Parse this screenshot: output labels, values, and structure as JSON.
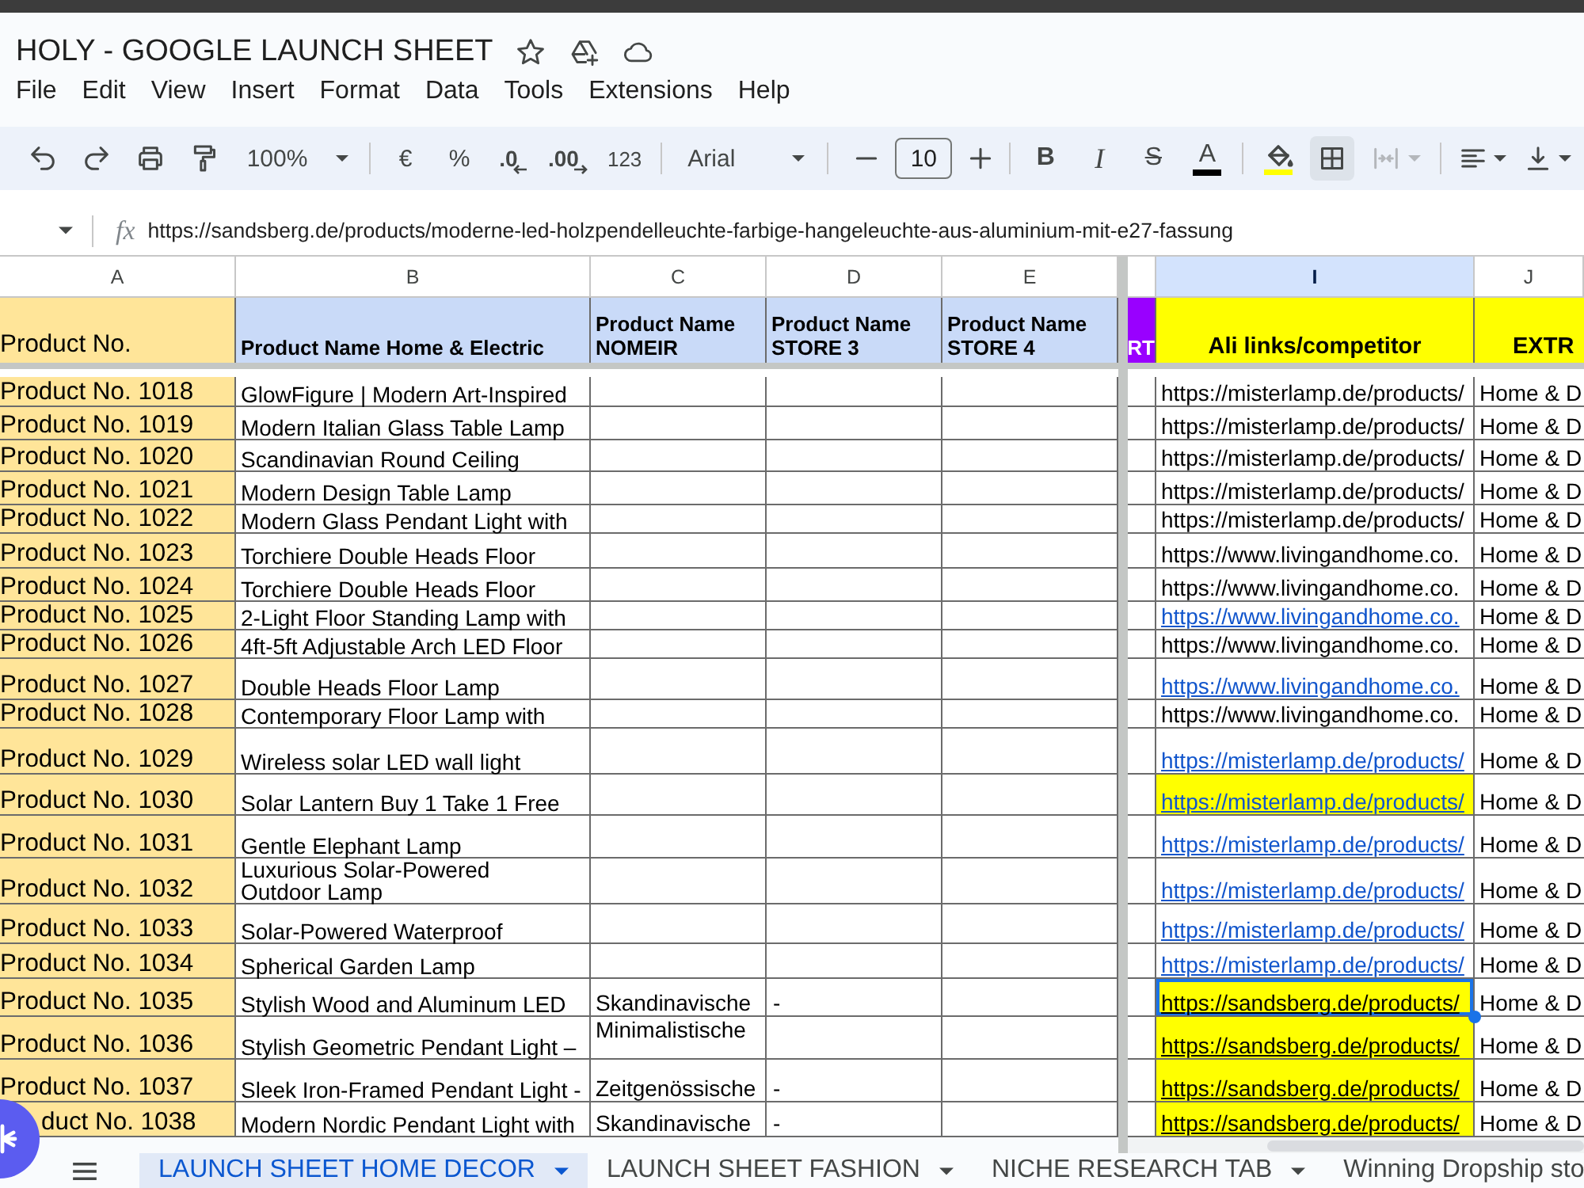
{
  "document": {
    "title": "HOLY - GOOGLE LAUNCH SHEET"
  },
  "menu": [
    "File",
    "Edit",
    "View",
    "Insert",
    "Format",
    "Data",
    "Tools",
    "Extensions",
    "Help"
  ],
  "toolbar": {
    "zoom": "100%",
    "currency": "€",
    "percent": "%",
    "decrease_decimals": ".0",
    "increase_decimals": ".00",
    "number_format": "123",
    "font": "Arial",
    "font_size": "10",
    "bold": "B",
    "italic": "I",
    "strikethrough": "S",
    "text_color": "A",
    "borders_selected": true,
    "merge_disabled": true
  },
  "formula_bar": {
    "label": "fx",
    "value": "https://sandsberg.de/products/moderne-led-holzpendelleuchte-farbige-hangeleuchte-aus-aluminium-mit-e27-fassung"
  },
  "columns": [
    {
      "letter": "A",
      "selected": false
    },
    {
      "letter": "B",
      "selected": false
    },
    {
      "letter": "C",
      "selected": false
    },
    {
      "letter": "D",
      "selected": false
    },
    {
      "letter": "E",
      "selected": false
    },
    {
      "selected": false
    },
    {
      "letter": "I",
      "selected": true
    },
    {
      "letter": "J",
      "selected": false
    }
  ],
  "header_row": [
    {
      "text": "Product No.",
      "color": "#ffe599"
    },
    {
      "text": "Product Name Home & Electric",
      "color": "#c9daf8"
    },
    {
      "text": "Product Name NOMEIR",
      "color": "#c9daf8"
    },
    {
      "text": "Product Name STORE 3",
      "color": "#c9daf8"
    },
    {
      "text": "Product Name STORE 4",
      "color": "#c9daf8"
    },
    {
      "text": "RT",
      "color": "#9900ff"
    },
    {
      "text": "Ali links/competitor",
      "color": "#ffff00"
    },
    {
      "text": "EXTR",
      "color": "#ffff00"
    }
  ],
  "rows": [
    {
      "product_no": "Product No. 1018",
      "name": "GlowFigure | Modern Art-Inspired",
      "link": {
        "text": "https://misterlamp.de/products/",
        "kind": "text",
        "highlighted": false,
        "selected": false
      },
      "column_j": "Home & D"
    },
    {
      "product_no": "Product No. 1019",
      "name": "Modern Italian Glass Table Lamp",
      "link": {
        "text": "https://misterlamp.de/products/",
        "kind": "text",
        "highlighted": false,
        "selected": false
      },
      "column_j": "Home & D"
    },
    {
      "product_no": "Product No. 1020",
      "name": "Scandinavian Round Ceiling",
      "link": {
        "text": "https://misterlamp.de/products/",
        "kind": "text",
        "highlighted": false,
        "selected": false
      },
      "column_j": "Home & D"
    },
    {
      "product_no": "Product No. 1021",
      "name": "Modern Design Table Lamp",
      "link": {
        "text": "https://misterlamp.de/products/",
        "kind": "text",
        "highlighted": false,
        "selected": false
      },
      "column_j": "Home & D"
    },
    {
      "product_no": "Product No. 1022",
      "name": "Modern Glass Pendant Light with",
      "link": {
        "text": "https://misterlamp.de/products/",
        "kind": "text",
        "highlighted": false,
        "selected": false
      },
      "column_j": "Home & D"
    },
    {
      "product_no": "Product No. 1023",
      "name": "Torchiere Double Heads Floor",
      "link": {
        "text": "https://www.livingandhome.co.",
        "kind": "text",
        "highlighted": false,
        "selected": false
      },
      "column_j": "Home & D"
    },
    {
      "product_no": "Product No. 1024",
      "name": "Torchiere Double Heads Floor",
      "link": {
        "text": "https://www.livingandhome.co.",
        "kind": "text",
        "highlighted": false,
        "selected": false
      },
      "column_j": "Home & D"
    },
    {
      "product_no": "Product No. 1025",
      "name": "2-Light Floor Standing Lamp with",
      "link": {
        "text": "https://www.livingandhome.co.",
        "kind": "link",
        "highlighted": false,
        "selected": false
      },
      "column_j": "Home & D"
    },
    {
      "product_no": "Product No. 1026",
      "name": "4ft-5ft Adjustable Arch LED Floor",
      "link": {
        "text": "https://www.livingandhome.co.",
        "kind": "text",
        "highlighted": false,
        "selected": false
      },
      "column_j": "Home & D"
    },
    {
      "product_no": "Product No. 1027",
      "name": "Double Heads Floor Lamp",
      "link": {
        "text": "https://www.livingandhome.co.",
        "kind": "link",
        "highlighted": false,
        "selected": false
      },
      "column_j": "Home & D"
    },
    {
      "product_no": "Product No. 1028",
      "name": "Contemporary Floor Lamp with",
      "link": {
        "text": "https://www.livingandhome.co.",
        "kind": "text",
        "highlighted": false,
        "selected": false
      },
      "column_j": "Home & D"
    },
    {
      "product_no": "Product No. 1029",
      "name": "Wireless solar LED wall light",
      "link": {
        "text": "https://misterlamp.de/products/",
        "kind": "link",
        "highlighted": false,
        "selected": false
      },
      "column_j": "Home & D"
    },
    {
      "product_no": "Product No. 1030",
      "name": "Solar Lantern Buy 1 Take 1 Free",
      "link": {
        "text": "https://misterlamp.de/products/",
        "kind": "link",
        "highlighted": true,
        "selected": false
      },
      "column_j": "Home & D"
    },
    {
      "product_no": "Product No. 1031",
      "name": "Gentle Elephant Lamp",
      "link": {
        "text": "https://misterlamp.de/products/",
        "kind": "link",
        "highlighted": false,
        "selected": false
      },
      "column_j": "Home & D"
    },
    {
      "product_no": "Product No. 1032",
      "name": "Luxurious Solar-Powered\nOutdoor Lamp",
      "link": {
        "text": "https://misterlamp.de/products/",
        "kind": "link",
        "highlighted": false,
        "selected": false
      },
      "column_j": "Home & D"
    },
    {
      "product_no": "Product No. 1033",
      "name": "Solar-Powered Waterproof",
      "link": {
        "text": "https://misterlamp.de/products/",
        "kind": "link",
        "highlighted": false,
        "selected": false
      },
      "column_j": "Home & D"
    },
    {
      "product_no": "Product No. 1034",
      "name": "Spherical Garden Lamp",
      "link": {
        "text": "https://misterlamp.de/products/",
        "kind": "link",
        "highlighted": false,
        "selected": false
      },
      "column_j": "Home & D"
    },
    {
      "product_no": "Product No. 1035",
      "name": "Stylish Wood and Aluminum LED",
      "name_nomeir": "Skandinavische",
      "name_store_3": "-",
      "link": {
        "text": "https://sandsberg.de/products/",
        "kind": "formatted_link",
        "highlighted": true,
        "selected": true
      },
      "column_j": "Home & D"
    },
    {
      "product_no": "Product No. 1036",
      "name": "Stylish Geometric Pendant Light –",
      "name_nomeir": "Minimalistische",
      "link": {
        "text": "https://sandsberg.de/products/",
        "kind": "formatted_link",
        "highlighted": true,
        "selected": false
      },
      "column_j": "Home & D"
    },
    {
      "product_no": "Product No. 1037",
      "name": "Sleek Iron-Framed Pendant Light -",
      "name_nomeir": "Zeitgenössische",
      "name_store_3": "-",
      "link": {
        "text": "https://sandsberg.de/products/",
        "kind": "formatted_link",
        "highlighted": true,
        "selected": false
      },
      "column_j": "Home & D"
    },
    {
      "product_no": "duct No. 1038",
      "name": "Modern Nordic Pendant Light with",
      "name_nomeir": "Skandinavische",
      "name_store_3": "-",
      "link": {
        "text": "https://sandsberg.de/products/",
        "kind": "formatted_link",
        "highlighted": true,
        "selected": false
      },
      "column_j": "Home & D"
    }
  ],
  "sheet_tabs": [
    {
      "name": "LAUNCH SHEET HOME DECOR",
      "selected": true
    },
    {
      "name": "LAUNCH SHEET FASHION",
      "selected": false
    },
    {
      "name": "NICHE RESEARCH TAB",
      "selected": false
    },
    {
      "name": "Winning Dropship sto",
      "selected": false
    }
  ]
}
